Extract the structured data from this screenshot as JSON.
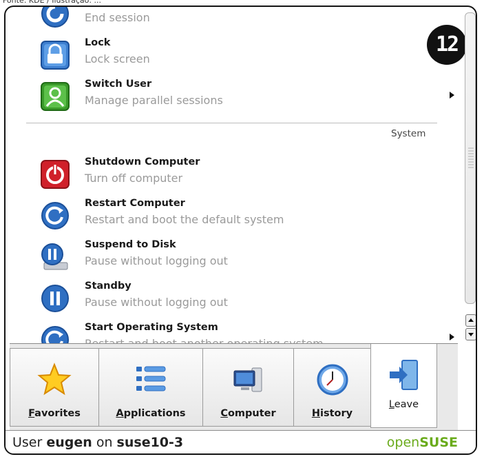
{
  "caption": "Fonte: KDE / Ilustração: ...",
  "badge": "12",
  "session_items": [
    {
      "title": "",
      "subtitle": "End session",
      "icon": "logout-icon"
    },
    {
      "title": "Lock",
      "subtitle": "Lock screen",
      "icon": "lock-icon"
    },
    {
      "title": "Switch User",
      "subtitle": "Manage parallel sessions",
      "icon": "switch-user-icon",
      "has_submenu": true
    }
  ],
  "section_label": "System",
  "system_items": [
    {
      "title": "Shutdown Computer",
      "subtitle": "Turn off computer",
      "icon": "power-icon"
    },
    {
      "title": "Restart Computer",
      "subtitle": "Restart and boot the default system",
      "icon": "restart-icon"
    },
    {
      "title": "Suspend to Disk",
      "subtitle": "Pause without logging out",
      "icon": "suspend-disk-icon"
    },
    {
      "title": "Standby",
      "subtitle": "Pause without logging out",
      "icon": "standby-icon"
    },
    {
      "title": "Start Operating System",
      "subtitle": "Restart and boot another operating system",
      "icon": "boot-os-icon",
      "has_submenu": true
    }
  ],
  "tabs": [
    {
      "label": "Favorites",
      "access_key": "F",
      "icon": "star-icon",
      "active": false
    },
    {
      "label": "Applications",
      "access_key": "A",
      "icon": "applications-list-icon",
      "active": false
    },
    {
      "label": "Computer",
      "access_key": "C",
      "icon": "computer-icon",
      "active": false
    },
    {
      "label": "History",
      "access_key": "H",
      "icon": "clock-icon",
      "active": false
    },
    {
      "label": "Leave",
      "access_key": "L",
      "icon": "leave-door-icon",
      "active": true
    }
  ],
  "footer": {
    "prefix": "User ",
    "username": "eugen",
    "middle": " on ",
    "hostname": "suse10-3",
    "brand_light": "open",
    "brand_bold": "SUSE"
  },
  "colors": {
    "brand_green": "#6aab1c",
    "icon_blue": "#2f6fc2",
    "shutdown_red": "#d0202a",
    "switch_green": "#3a9a2a"
  }
}
